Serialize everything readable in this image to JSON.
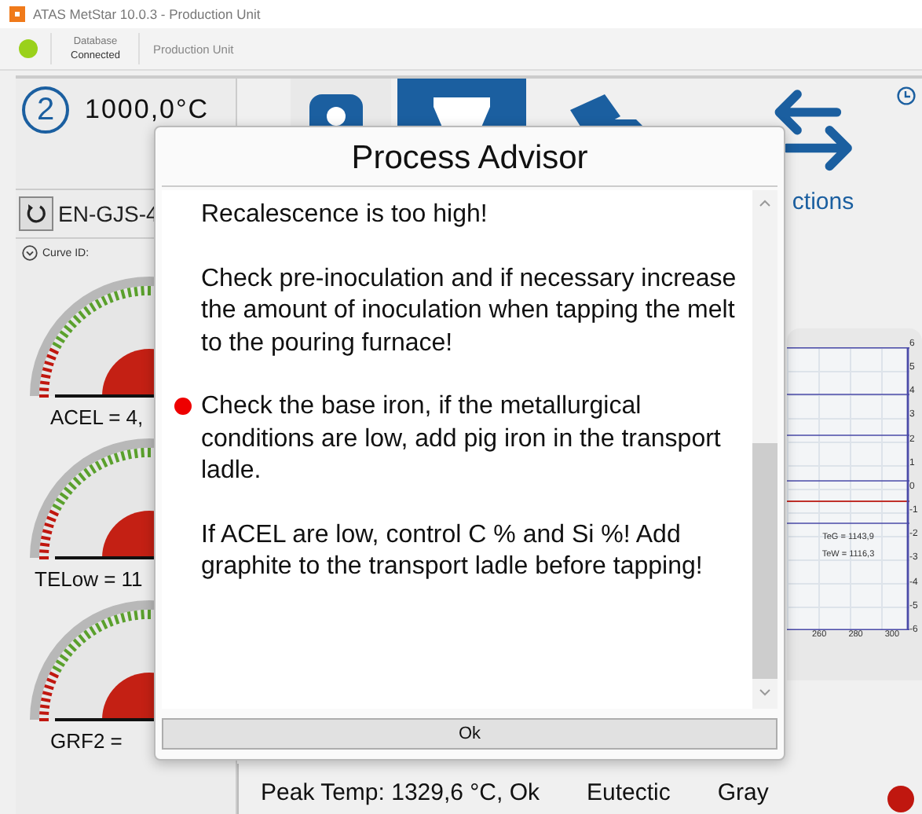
{
  "window": {
    "title": "ATAS MetStar 10.0.3 - Production Unit"
  },
  "toolbar": {
    "database_connected": true,
    "database_label": "Database",
    "database_state": "Connected",
    "unit": "Production Unit"
  },
  "header": {
    "station": "2",
    "temperature": "1000,0°C"
  },
  "tiles": [
    {
      "kind": "sample",
      "selected": false
    },
    {
      "kind": "ladle",
      "selected": true
    },
    {
      "kind": "documents",
      "selected": false
    },
    {
      "kind": "arrows",
      "selected": false,
      "label": "ctions"
    }
  ],
  "left": {
    "grade": "EN-GJS-4",
    "curve_id": "Curve ID:",
    "gauges": [
      {
        "label": "ACEL = 4,"
      },
      {
        "label": "TELow = 11"
      },
      {
        "label": "GRF2 = "
      }
    ]
  },
  "chart": {
    "y_labels": [
      "6",
      "5",
      "4",
      "3",
      "2",
      "1",
      "0",
      "-1",
      "-2",
      "-3",
      "-4",
      "-5",
      "-6"
    ],
    "x_labels": [
      "260",
      "280",
      "300"
    ],
    "notes": [
      "TeG = 1143,9",
      "TeW = 1116,3"
    ]
  },
  "status": [
    {
      "text": "Peak Temp: 1329,6 °C, Ok"
    },
    {
      "text": "Eutectic"
    },
    {
      "text": "Gray"
    }
  ],
  "alarm": {
    "color": "#c0170f"
  },
  "dialog": {
    "title": "Process Advisor",
    "paragraphs": [
      {
        "text": "Recalescence is too high!",
        "marked": false
      },
      {
        "text": "Check pre-inoculation and if necessary increase the amount of inoculation when tapping the melt to the pouring furnace!",
        "marked": false
      },
      {
        "text": "Check the base iron, if the metallurgical conditions are low, add pig iron in the transport ladle.",
        "marked": true
      },
      {
        "text": "If ACEL are low, control C % and Si %! Add graphite to the transport ladle before tapping!",
        "marked": false
      }
    ],
    "button": "Ok"
  }
}
